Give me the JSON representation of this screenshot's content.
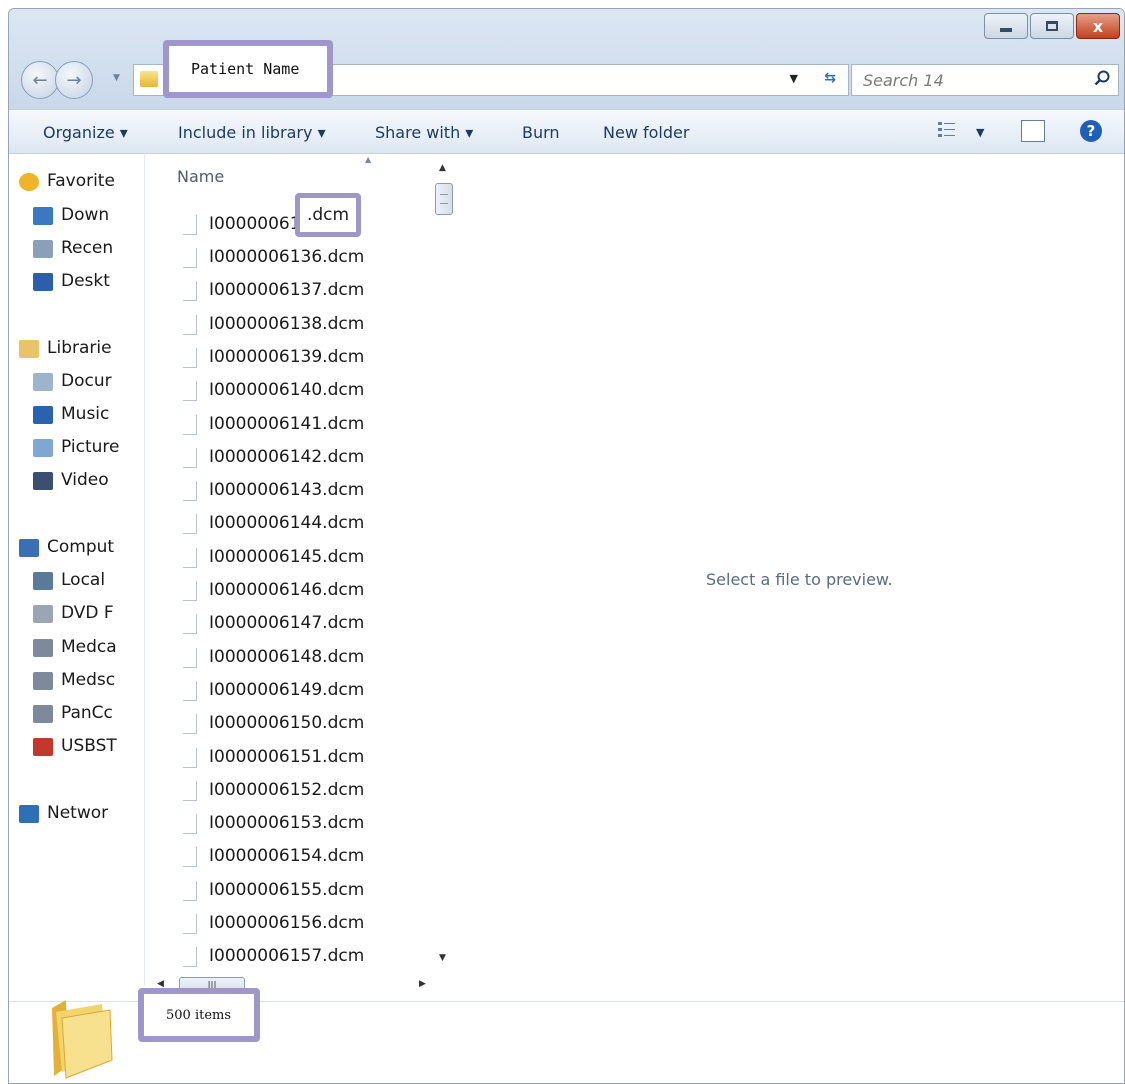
{
  "window": {
    "controls": [
      "minimize",
      "maximize",
      "close"
    ],
    "close_symbol": "x"
  },
  "address": {
    "path": "Patient Name"
  },
  "search": {
    "placeholder": "Search 14"
  },
  "toolbar": {
    "organize": "Organize",
    "include_in_library": "Include in library",
    "share_with": "Share with",
    "burn": "Burn",
    "new_folder": "New folder",
    "dropdown_symbol": "▾"
  },
  "navigation": {
    "items": [
      {
        "label": "Favorite",
        "icon": "star-icon",
        "indent": false
      },
      {
        "label": "Down",
        "icon": "downloads-icon",
        "indent": true
      },
      {
        "label": "Recen",
        "icon": "recent-places-icon",
        "indent": true
      },
      {
        "label": "Deskt",
        "icon": "desktop-icon",
        "indent": true
      },
      {
        "label": "Librarie",
        "icon": "libraries-icon",
        "indent": false
      },
      {
        "label": "Docur",
        "icon": "documents-icon",
        "indent": true
      },
      {
        "label": "Music",
        "icon": "music-icon",
        "indent": true
      },
      {
        "label": "Picture",
        "icon": "pictures-icon",
        "indent": true
      },
      {
        "label": "Video",
        "icon": "videos-icon",
        "indent": true
      },
      {
        "label": "Comput",
        "icon": "computer-icon",
        "indent": false
      },
      {
        "label": "Local",
        "icon": "local-disk-icon",
        "indent": true
      },
      {
        "label": "DVD F",
        "icon": "dvd-drive-icon",
        "indent": true
      },
      {
        "label": "Medca",
        "icon": "network-drive-icon",
        "indent": true
      },
      {
        "label": "Medsc",
        "icon": "network-drive-icon",
        "indent": true
      },
      {
        "label": "PanCc",
        "icon": "network-drive-icon",
        "indent": true
      },
      {
        "label": "USBST",
        "icon": "disconnected-drive-icon",
        "indent": true
      },
      {
        "label": "Networ",
        "icon": "network-icon",
        "indent": false
      }
    ]
  },
  "file_list": {
    "column_name": "Name",
    "first_file_prefix": "I000000613",
    "first_file_extension": ".dcm",
    "files": [
      "I0000006136.dcm",
      "I0000006137.dcm",
      "I0000006138.dcm",
      "I0000006139.dcm",
      "I0000006140.dcm",
      "I0000006141.dcm",
      "I0000006142.dcm",
      "I0000006143.dcm",
      "I0000006144.dcm",
      "I0000006145.dcm",
      "I0000006146.dcm",
      "I0000006147.dcm",
      "I0000006148.dcm",
      "I0000006149.dcm",
      "I0000006150.dcm",
      "I0000006151.dcm",
      "I0000006152.dcm",
      "I0000006153.dcm",
      "I0000006154.dcm",
      "I0000006155.dcm",
      "I0000006156.dcm",
      "I0000006157.dcm"
    ]
  },
  "scrollbar": {
    "hthumb_grip": "III"
  },
  "preview": {
    "message": "Select a file to preview."
  },
  "status": {
    "item_count": "500 items"
  },
  "colors": {
    "callout_border": "#9f97c9",
    "titlebar": "#c9d8ea",
    "close_button": "#c0401e"
  }
}
